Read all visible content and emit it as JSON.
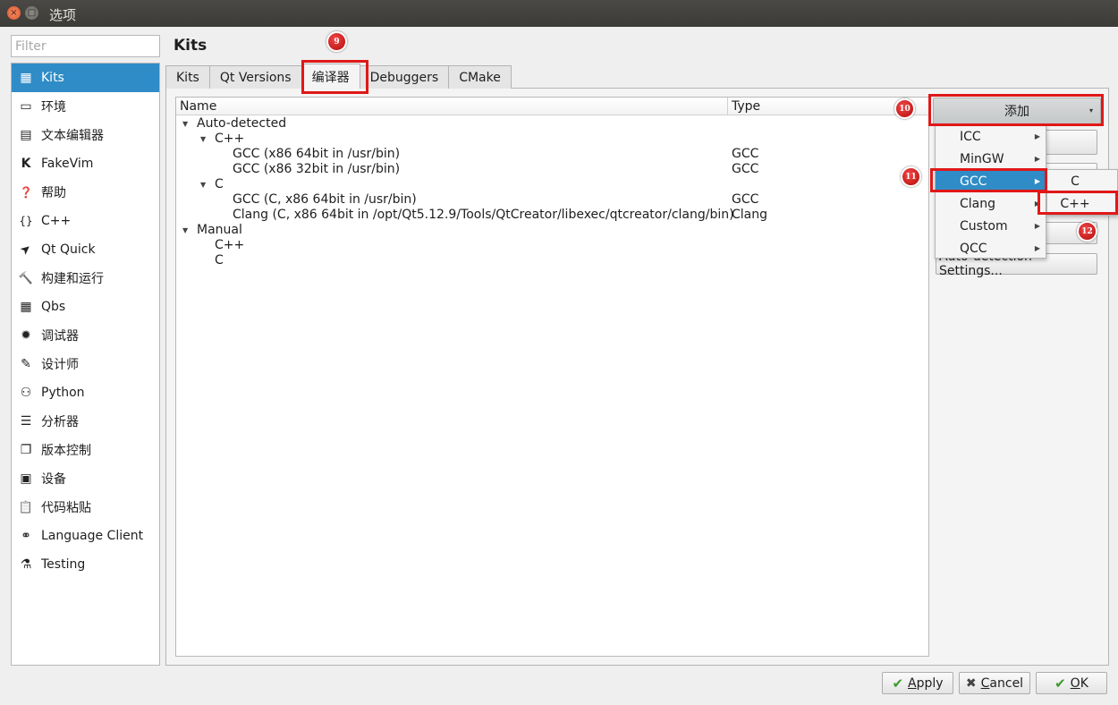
{
  "window": {
    "title": "选项",
    "close_glyph": "×",
    "max_glyph": "□"
  },
  "sidebar": {
    "filter_placeholder": "Filter",
    "items": [
      {
        "label": "Kits",
        "icon": "kits-icon",
        "glyph": "▦"
      },
      {
        "label": "环境",
        "icon": "monitor-icon",
        "glyph": "▭"
      },
      {
        "label": "文本编辑器",
        "icon": "text-editor-icon",
        "glyph": "▤"
      },
      {
        "label": "FakeVim",
        "icon": "fakevim-icon",
        "glyph": "K"
      },
      {
        "label": "帮助",
        "icon": "help-icon",
        "glyph": "❓"
      },
      {
        "label": "C++",
        "icon": "cpp-braces-icon",
        "glyph": "{}"
      },
      {
        "label": "Qt Quick",
        "icon": "qt-quick-icon",
        "glyph": "➤"
      },
      {
        "label": "构建和运行",
        "icon": "hammer-icon",
        "glyph": "🔨"
      },
      {
        "label": "Qbs",
        "icon": "qbs-icon",
        "glyph": "▦"
      },
      {
        "label": "调试器",
        "icon": "bug-icon",
        "glyph": "✹"
      },
      {
        "label": "设计师",
        "icon": "pen-icon",
        "glyph": "✎"
      },
      {
        "label": "Python",
        "icon": "python-icon",
        "glyph": "⚇"
      },
      {
        "label": "分析器",
        "icon": "analyzer-icon",
        "glyph": "☰"
      },
      {
        "label": "版本控制",
        "icon": "version-control-icon",
        "glyph": "❐"
      },
      {
        "label": "设备",
        "icon": "device-icon",
        "glyph": "▣"
      },
      {
        "label": "代码粘贴",
        "icon": "paste-icon",
        "glyph": "📋"
      },
      {
        "label": "Language Client",
        "icon": "language-client-icon",
        "glyph": "⚭"
      },
      {
        "label": "Testing",
        "icon": "flask-icon",
        "glyph": "⚗"
      }
    ]
  },
  "main": {
    "title": "Kits",
    "tabs": [
      {
        "label": "Kits"
      },
      {
        "label": "Qt Versions"
      },
      {
        "label": "编译器"
      },
      {
        "label": "Debuggers"
      },
      {
        "label": "CMake"
      }
    ],
    "tree": {
      "col_name": "Name",
      "col_type": "Type",
      "rows": [
        {
          "name": "Auto-detected",
          "type": "",
          "arrow": "▼"
        },
        {
          "name": "C++",
          "type": "",
          "arrow": "▼"
        },
        {
          "name": "GCC (x86 64bit in /usr/bin)",
          "type": "GCC",
          "arrow": ""
        },
        {
          "name": "GCC (x86 32bit in /usr/bin)",
          "type": "GCC",
          "arrow": ""
        },
        {
          "name": "C",
          "type": "",
          "arrow": "▼"
        },
        {
          "name": "GCC (C, x86 64bit in /usr/bin)",
          "type": "GCC",
          "arrow": ""
        },
        {
          "name": "Clang (C, x86 64bit in /opt/Qt5.12.9/Tools/QtCreator/libexec/qtcreator/clang/bin)",
          "type": "Clang",
          "arrow": ""
        },
        {
          "name": "Manual",
          "type": "",
          "arrow": "▼"
        },
        {
          "name": "C++",
          "type": "",
          "arrow": ""
        },
        {
          "name": "C",
          "type": "",
          "arrow": ""
        }
      ]
    },
    "add_button": "添加",
    "add_caret": "▾",
    "autodetect_button": "Auto-detection Settings...",
    "add_menu": [
      {
        "label": "ICC"
      },
      {
        "label": "MinGW"
      },
      {
        "label": "GCC"
      },
      {
        "label": "Clang"
      },
      {
        "label": "Custom"
      },
      {
        "label": "QCC"
      }
    ],
    "submenu_arrow": "▶",
    "gcc_submenu": [
      {
        "label": "C"
      },
      {
        "label": "C++"
      }
    ]
  },
  "annotations": [
    "9",
    "10",
    "11",
    "12"
  ],
  "footer": {
    "apply": {
      "prefix": "",
      "underlined": "A",
      "suffix": "pply",
      "glyph": "✔"
    },
    "cancel": {
      "prefix": "",
      "underlined": "C",
      "suffix": "ancel",
      "glyph": "✖"
    },
    "ok": {
      "prefix": "",
      "underlined": "O",
      "suffix": "K",
      "glyph": "✔"
    }
  },
  "colors": {
    "highlight": "#308cc6",
    "annotation_red": "#e01818"
  }
}
